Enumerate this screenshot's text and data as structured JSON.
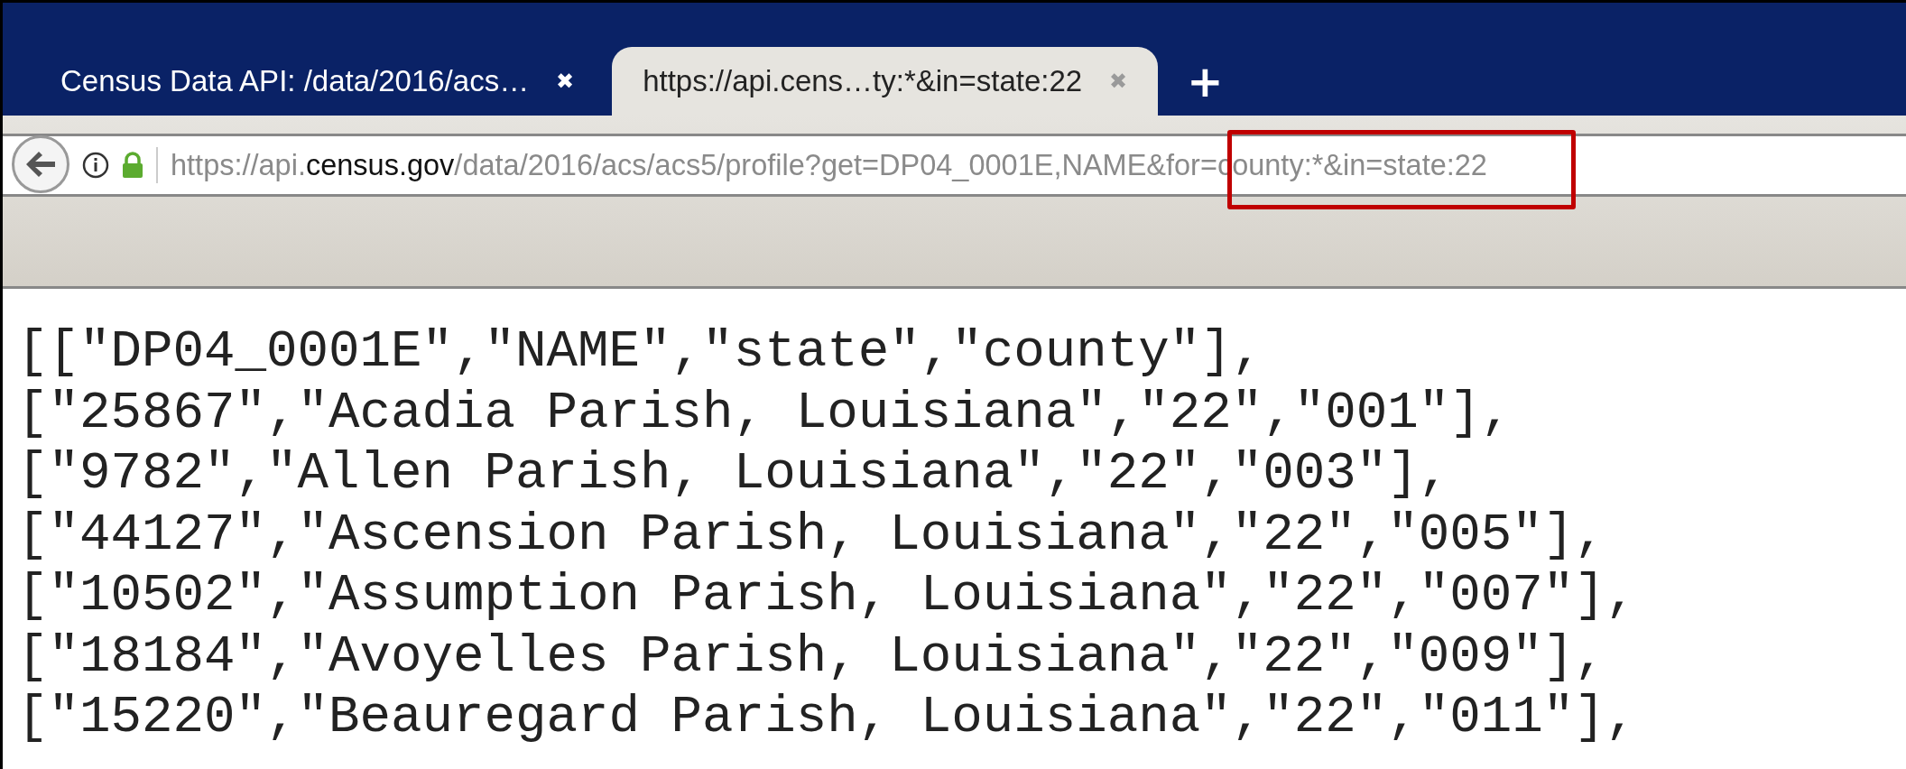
{
  "tabs": [
    {
      "title": "Census Data API: /data/2016/acs…",
      "close": "✖",
      "selected": false
    },
    {
      "title": "https://api.cens…ty:*&in=state:22",
      "close": "✖",
      "selected": true
    }
  ],
  "new_tab": "+",
  "address_bar": {
    "prefix": "https://api.",
    "domain": "census.gov",
    "path": "/data/2016/acs/acs5/profile?get=DP04_0001E,NAME&for=county:*&in=state:22",
    "highlighted": true
  },
  "content": {
    "lines": [
      "[[\"DP04_0001E\",\"NAME\",\"state\",\"county\"],",
      "[\"25867\",\"Acadia Parish, Louisiana\",\"22\",\"001\"],",
      "[\"9782\",\"Allen Parish, Louisiana\",\"22\",\"003\"],",
      "[\"44127\",\"Ascension Parish, Louisiana\",\"22\",\"005\"],",
      "[\"10502\",\"Assumption Parish, Louisiana\",\"22\",\"007\"],",
      "[\"18184\",\"Avoyelles Parish, Louisiana\",\"22\",\"009\"],",
      "[\"15220\",\"Beauregard Parish, Louisiana\",\"22\",\"011\"],"
    ]
  }
}
